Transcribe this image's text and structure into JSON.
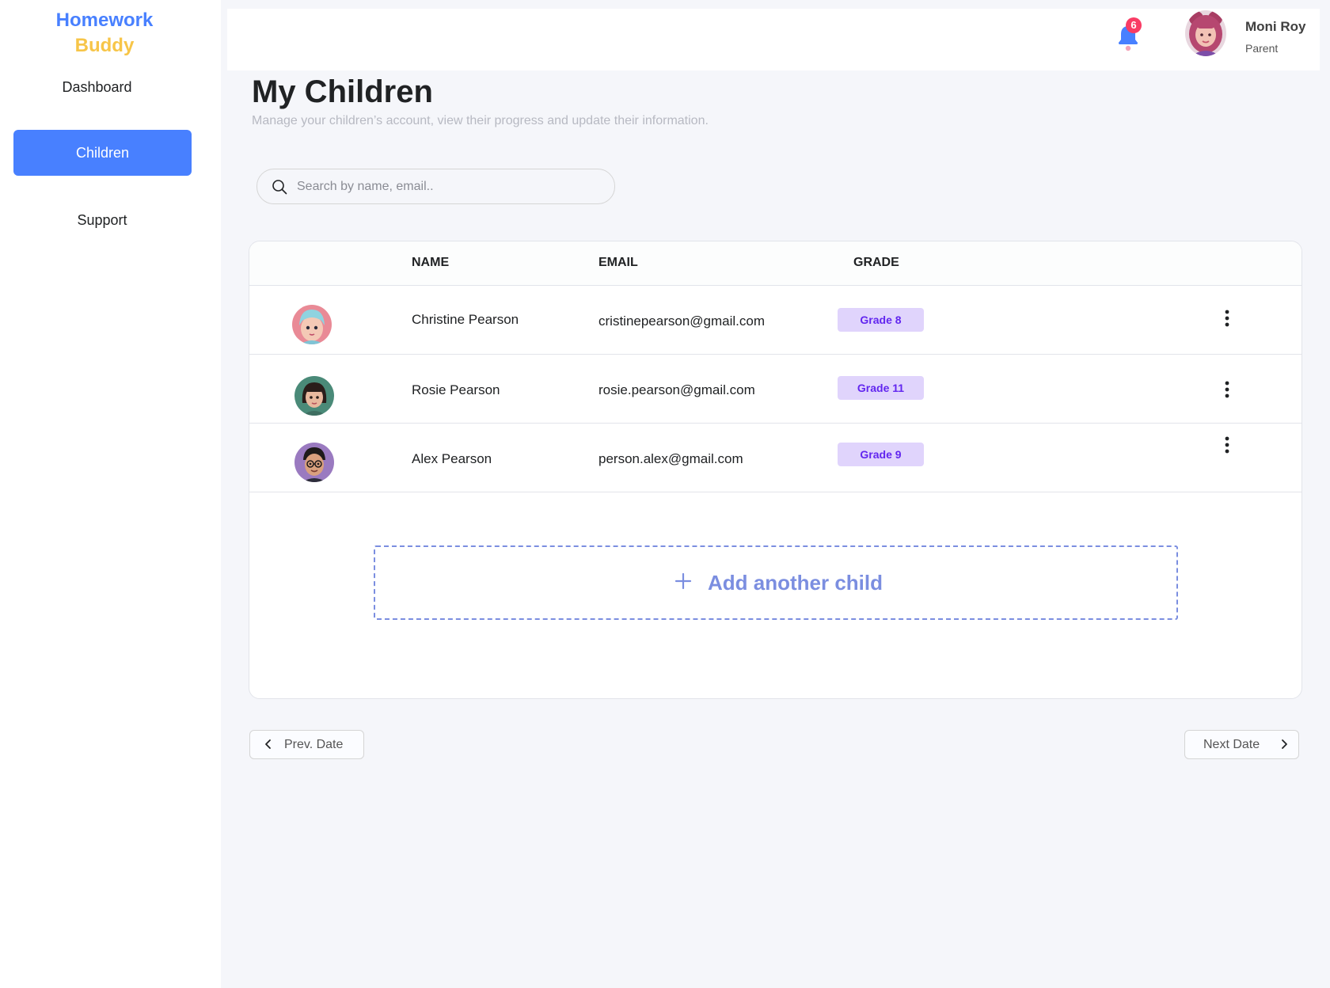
{
  "brand": {
    "line1": "Homework",
    "line2": "Buddy"
  },
  "sidebar": {
    "items": [
      {
        "label": "Dashboard",
        "active": false
      },
      {
        "label": "Children",
        "active": true
      },
      {
        "label": "Support",
        "active": false
      }
    ]
  },
  "header": {
    "notifications": {
      "count": "6",
      "icon": "bell-icon"
    },
    "user": {
      "name": "Moni Roy",
      "role": "Parent"
    }
  },
  "page": {
    "title": "My Children",
    "subtitle": "Manage your children’s account, view their progress and update their information."
  },
  "search": {
    "placeholder": "Search by name, email.."
  },
  "table": {
    "columns": [
      "NAME",
      "EMAIL",
      "GRADE"
    ],
    "rows": [
      {
        "name": "Christine Pearson",
        "email": "cristinepearson@gmail.com",
        "grade": "Grade 8"
      },
      {
        "name": "Rosie Pearson",
        "email": "rosie.pearson@gmail.com",
        "grade": "Grade 11"
      },
      {
        "name": "Alex Pearson",
        "email": "person.alex@gmail.com",
        "grade": "Grade 9"
      }
    ]
  },
  "add_child": {
    "label": "Add another child"
  },
  "pagination": {
    "prev_label": "Prev. Date",
    "next_label": "Next Date"
  },
  "colors": {
    "accent": "#4880ff",
    "brand_secondary": "#f7c548",
    "badge_bg": "#e0d4fc",
    "badge_text": "#6226ef",
    "add_child": "#7b8ee0",
    "notification": "#f93c65"
  }
}
